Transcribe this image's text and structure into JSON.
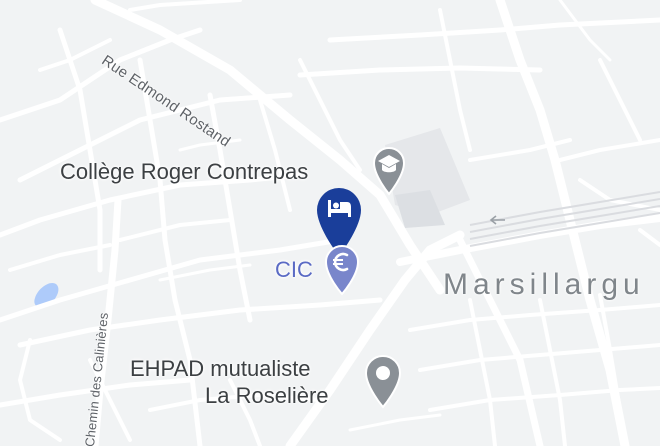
{
  "map": {
    "colors": {
      "background": "#f1f3f4",
      "road": "#ffffff",
      "water": "#aecbfa",
      "marker_hotel": "#1a3e9a",
      "marker_bank": "#7986cb",
      "marker_poi": "#8a9096"
    },
    "streets": {
      "rue_edmond_rostand": "Rue Edmond Rostand",
      "chemin_des_calinieres": "Chemin des Calinières"
    },
    "places": {
      "college": "Collège Roger Contrepas",
      "bank": "CIC",
      "ehpad_line1": "EHPAD mutualiste",
      "ehpad_line2": "La Roselière",
      "town": "Marsillargu"
    },
    "icons": {
      "hotel": "hotel-bed-icon",
      "bank": "euro-icon",
      "school": "graduation-cap-icon",
      "generic": "place-pin-icon",
      "railway": "railway-direction-arrow-icon"
    }
  }
}
